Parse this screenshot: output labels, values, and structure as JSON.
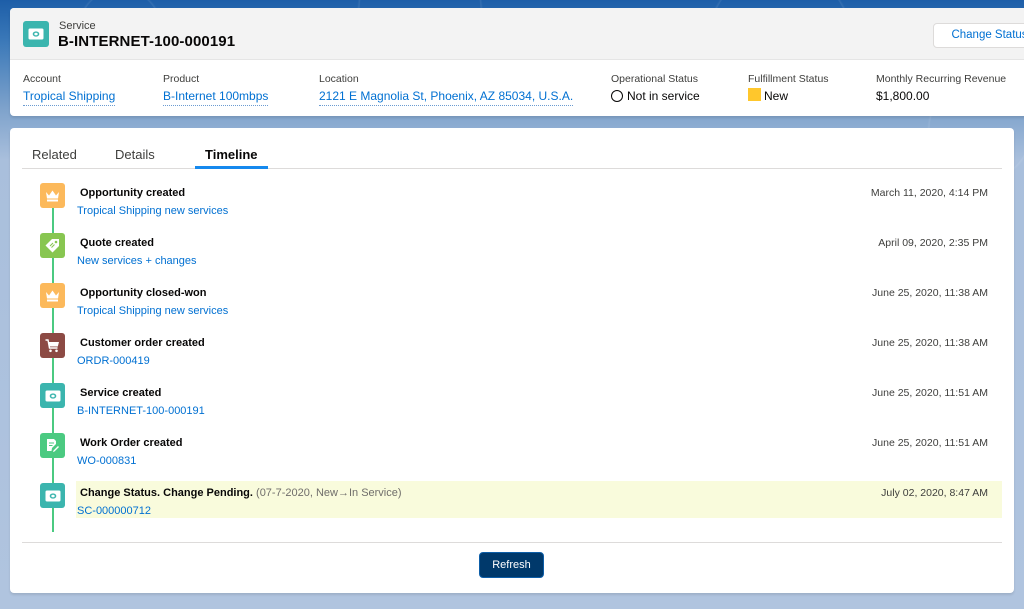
{
  "header": {
    "record_type": "Service",
    "record_title": "B-INTERNET-100-000191",
    "record_icon": "service-icon",
    "change_status_label": "Change Status",
    "fields": [
      {
        "label": "Account",
        "value": "Tropical Shipping",
        "type": "link"
      },
      {
        "label": "Product",
        "value": "B-Internet 100mbps",
        "type": "link"
      },
      {
        "label": "Location",
        "value": "2121 E Magnolia St, Phoenix, AZ 85034, U.S.A.",
        "type": "link"
      },
      {
        "label": "Operational Status",
        "value": "Not in service",
        "type": "status",
        "icon": "empty-circle-icon"
      },
      {
        "label": "Fulfillment Status",
        "value": "New",
        "type": "status",
        "icon": "yellow-square-icon",
        "color": "#ffc72c"
      },
      {
        "label": "Monthly Recurring Revenue",
        "value": "$1,800.00",
        "type": "text"
      }
    ]
  },
  "tabs": [
    {
      "label": "Related",
      "active": false
    },
    {
      "label": "Details",
      "active": false
    },
    {
      "label": "Timeline",
      "active": true
    }
  ],
  "timeline": {
    "items": [
      {
        "title": "Opportunity created",
        "subtitle": "",
        "link": "Tropical Shipping new services",
        "date": "March 11, 2020, 4:14 PM",
        "icon": "opportunity-crown-icon",
        "color": "#fcb95b",
        "highlighted": false
      },
      {
        "title": "Quote created",
        "subtitle": "",
        "link": "New services + changes",
        "date": "April 09, 2020, 2:35 PM",
        "icon": "quote-tag-icon",
        "color": "#88c651",
        "highlighted": false
      },
      {
        "title": "Opportunity closed-won",
        "subtitle": "",
        "link": "Tropical Shipping new services",
        "date": "June 25, 2020, 11:38 AM",
        "icon": "opportunity-crown-icon",
        "color": "#fcb95b",
        "highlighted": false
      },
      {
        "title": "Customer order created",
        "subtitle": "",
        "link": "ORDR-000419",
        "date": "June 25, 2020, 11:38 AM",
        "icon": "cart-icon",
        "color": "#8c4a44",
        "highlighted": false
      },
      {
        "title": "Service created",
        "subtitle": "",
        "link": "B-INTERNET-100-000191",
        "date": "June 25, 2020, 11:51 AM",
        "icon": "service-icon",
        "color": "#3bb5ae",
        "highlighted": false
      },
      {
        "title": "Work Order created",
        "subtitle": "",
        "link": "WO-000831",
        "date": "June 25, 2020, 11:51 AM",
        "icon": "work-order-icon",
        "color": "#4bca81",
        "highlighted": false
      },
      {
        "title": "Change Status. Change Pending.",
        "subtitle": "(07-7-2020, New→In Service)",
        "link": "SC-000000712",
        "date": "July 02, 2020, 8:47 AM",
        "icon": "service-icon",
        "color": "#3bb5ae",
        "highlighted": true
      }
    ]
  },
  "footer": {
    "refresh_label": "Refresh"
  },
  "colors": {
    "link": "#0070d2",
    "timeline_line": "#4bca81",
    "highlight_bg": "#f9fbdc",
    "brand_button": "#00396b",
    "active_tab_underline": "#1589ee"
  }
}
